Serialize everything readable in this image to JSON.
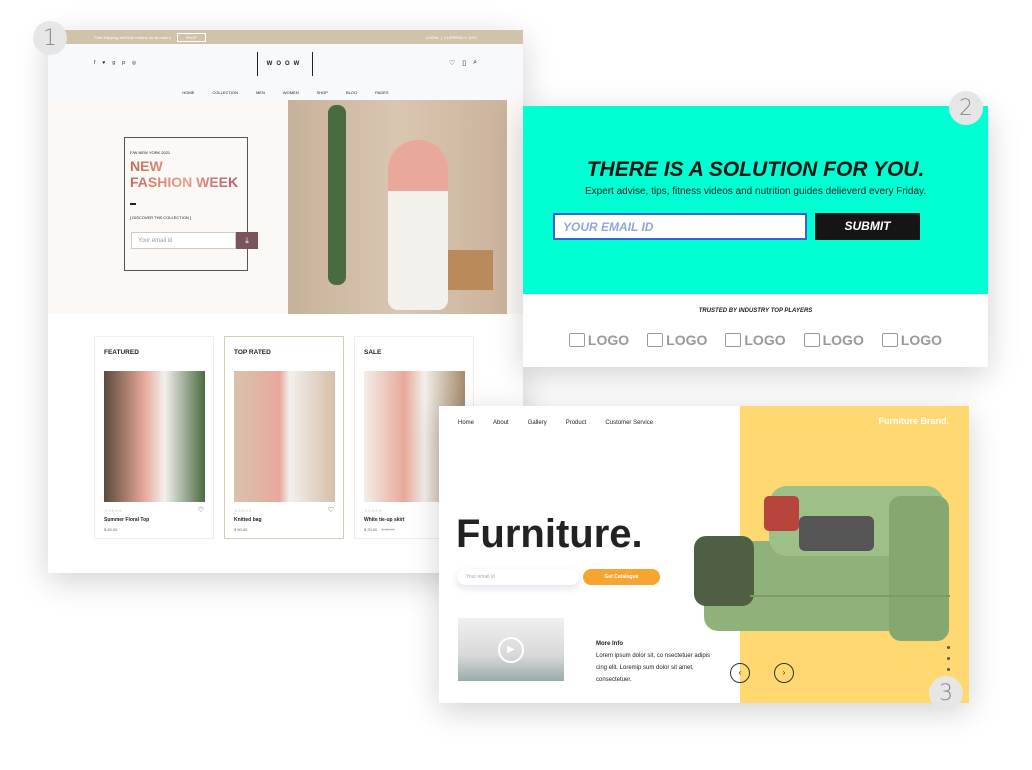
{
  "badges": [
    "1",
    "2",
    "3"
  ],
  "fashion": {
    "topbar": {
      "promo": "Free shipping and free returns on all orders",
      "promo_button": "SHOP",
      "login": "LOGIN",
      "currency": "CURRENCY: USD"
    },
    "social_icons": [
      "facebook-icon",
      "twitter-icon",
      "google-plus-icon",
      "pinterest-icon",
      "instagram-icon"
    ],
    "logo": "WOOW",
    "nav": [
      "HOME",
      "COLLECTION",
      "MEN",
      "WOMEN",
      "SHOP",
      "BLOG",
      "PAGES"
    ],
    "hero": {
      "kicker": "F/W NEW YORK 2021",
      "title_line1": "NEW",
      "title_line2": "FASHION WEEK",
      "discover": "[ DISCOVER THE COLLECTION ]",
      "email_placeholder": "Your email id"
    },
    "cards": [
      {
        "heading": "FEATURED",
        "name": "Summer Floral Top",
        "price": "$ 65.00",
        "old_price": ""
      },
      {
        "heading": "TOP RATED",
        "name": "Knitted bag",
        "price": "$ 50.00",
        "old_price": ""
      },
      {
        "heading": "SALE",
        "name": "White tie-up skirt",
        "price": "$ 20.00",
        "old_price": "$ 35.00"
      }
    ],
    "stars": "☆☆☆☆☆"
  },
  "newsletter": {
    "title": "THERE IS A SOLUTION FOR YOU.",
    "subtitle": "Expert advise, tips, fitness videos and nutrition guides delieverd every Friday.",
    "email_placeholder": "YOUR EMAIL ID",
    "submit": "SUBMIT",
    "trusted": "TRUSTED BY INDUSTRY TOP PLAYERS",
    "logos": [
      "LOGO",
      "LOGO",
      "LOGO",
      "LOGO",
      "LOGO"
    ],
    "accent": "#00ffd2"
  },
  "furniture": {
    "nav": [
      "Home",
      "About",
      "Gallery",
      "Product",
      "Customer Service"
    ],
    "brand": "Furniture Brand.",
    "title": "Furniture.",
    "email_placeholder": "Your email id",
    "cta": "Get Catalogue",
    "more_title": "More Info",
    "more_text": "Lorem ipsum dolor sit, co nsectetuer adipis cing elit. Loremip sum dolor sit amet, consectetuer.",
    "accent": "#ffd872",
    "cta_color": "#f6a530"
  }
}
